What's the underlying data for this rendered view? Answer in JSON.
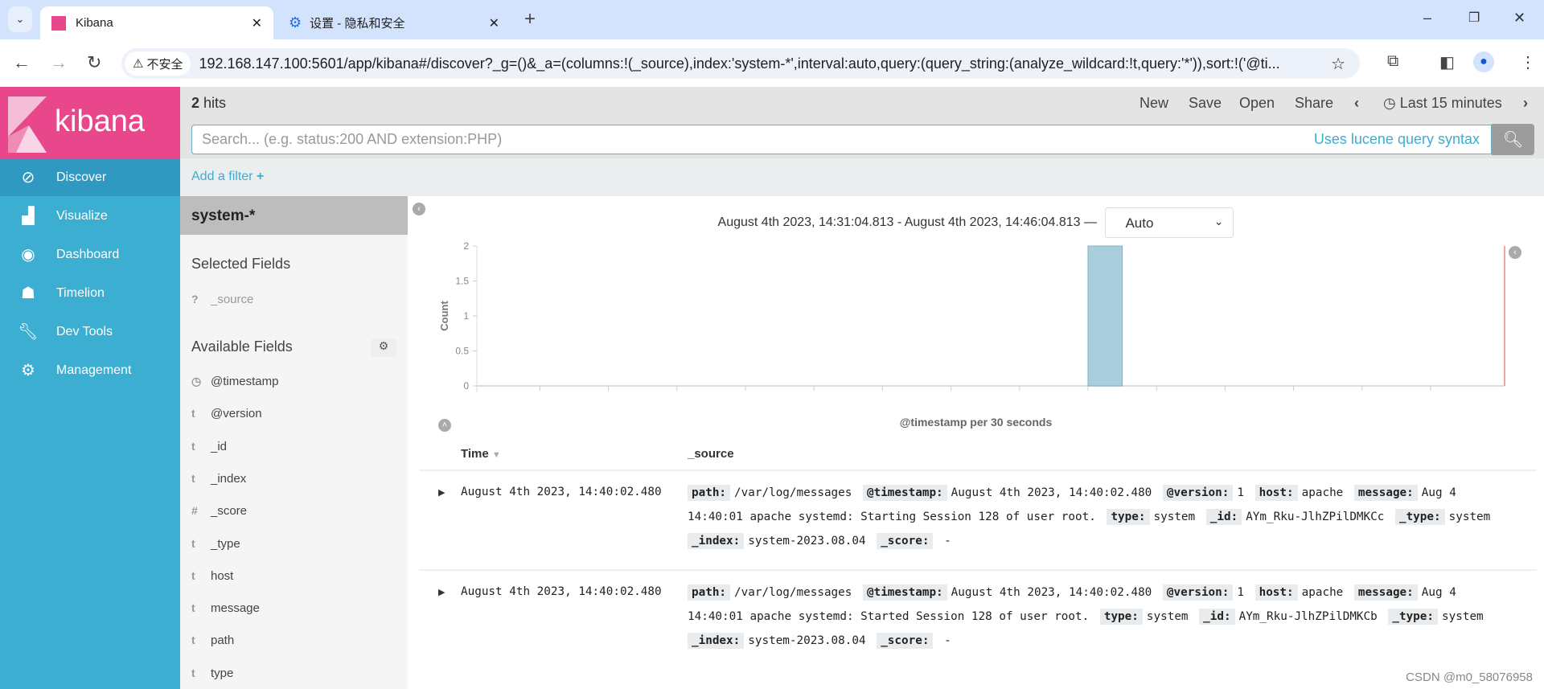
{
  "browser": {
    "tabs": [
      {
        "title": "Kibana",
        "active": true
      },
      {
        "title": "设置 - 隐私和安全",
        "active": false
      }
    ],
    "security_label": "不安全",
    "url": "192.168.147.100:5601/app/kibana#/discover?_g=()&_a=(columns:!(_source),index:'system-*',interval:auto,query:(query_string:(analyze_wildcard:!t,query:'*')),sort:!('@ti..."
  },
  "nav": {
    "logo": "kibana",
    "items": [
      {
        "label": "Discover",
        "icon": "compass-icon",
        "active": true
      },
      {
        "label": "Visualize",
        "icon": "bar-chart-icon"
      },
      {
        "label": "Dashboard",
        "icon": "dashboard-icon"
      },
      {
        "label": "Timelion",
        "icon": "timelion-icon"
      },
      {
        "label": "Dev Tools",
        "icon": "wrench-icon"
      },
      {
        "label": "Management",
        "icon": "gear-icon"
      }
    ]
  },
  "topbar": {
    "hits_count": "2",
    "hits_label": "hits",
    "menu": [
      "New",
      "Save",
      "Open",
      "Share"
    ],
    "time_range": "Last 15 minutes"
  },
  "search": {
    "placeholder": "Search... (e.g. status:200 AND extension:PHP)",
    "hint": "Uses lucene query syntax"
  },
  "filter": {
    "add_label": "Add a filter"
  },
  "fields": {
    "index_pattern": "system-*",
    "selected_title": "Selected Fields",
    "selected": [
      {
        "type": "?",
        "name": "_source"
      }
    ],
    "available_title": "Available Fields",
    "available": [
      {
        "type": "clock",
        "name": "@timestamp"
      },
      {
        "type": "t",
        "name": "@version"
      },
      {
        "type": "t",
        "name": "_id"
      },
      {
        "type": "t",
        "name": "_index"
      },
      {
        "type": "#",
        "name": "_score"
      },
      {
        "type": "t",
        "name": "_type"
      },
      {
        "type": "t",
        "name": "host"
      },
      {
        "type": "t",
        "name": "message"
      },
      {
        "type": "t",
        "name": "path"
      },
      {
        "type": "t",
        "name": "type"
      }
    ]
  },
  "main": {
    "date_range": "August 4th 2023, 14:31:04.813 - August 4th 2023, 14:46:04.813 —",
    "interval": "Auto"
  },
  "chart_data": {
    "type": "bar",
    "xlabel": "@timestamp per 30 seconds",
    "ylabel": "Count",
    "x_range": [
      "14:31:04.813",
      "14:46:04.813"
    ],
    "ylim": [
      0,
      2
    ],
    "yticks": [
      "0",
      "0.5",
      "1",
      "1.5",
      "2"
    ],
    "xticks": [
      "14:32:00",
      "14:33:00",
      "14:34:00",
      "14:35:00",
      "14:36:00",
      "14:37:00",
      "14:38:00",
      "14:39:00",
      "14:40:00",
      "14:41:00",
      "14:42:00",
      "14:43:00",
      "14:44:00",
      "14:45:00"
    ],
    "bars": [
      {
        "x": "14:40:00",
        "count": 2
      }
    ],
    "bar_color": "#a8cfdb",
    "now_line_color": "#f0a3a3"
  },
  "table": {
    "headers": [
      "Time",
      "_source"
    ],
    "rows": [
      {
        "time": "August 4th 2023, 14:40:02.480",
        "source": [
          [
            "path:",
            "/var/log/messages"
          ],
          [
            "@timestamp:",
            "August 4th 2023, 14:40:02.480"
          ],
          [
            "@version:",
            "1"
          ],
          [
            "host:",
            "apache"
          ],
          [
            "message:",
            "Aug 4 14:40:01 apache systemd: Starting Session 128 of user root."
          ],
          [
            "type:",
            "system"
          ],
          [
            "_id:",
            "AYm_Rku-JlhZPilDMKCc"
          ],
          [
            "_type:",
            "system"
          ],
          [
            "_index:",
            "system-2023.08.04"
          ],
          [
            "_score:",
            " -"
          ]
        ]
      },
      {
        "time": "August 4th 2023, 14:40:02.480",
        "source": [
          [
            "path:",
            "/var/log/messages"
          ],
          [
            "@timestamp:",
            "August 4th 2023, 14:40:02.480"
          ],
          [
            "@version:",
            "1"
          ],
          [
            "host:",
            "apache"
          ],
          [
            "message:",
            "Aug 4 14:40:01 apache systemd: Started Session 128 of user root."
          ],
          [
            "type:",
            "system"
          ],
          [
            "_id:",
            "AYm_Rku-JlhZPilDMKCb"
          ],
          [
            "_type:",
            "system"
          ],
          [
            "_index:",
            "system-2023.08.04"
          ],
          [
            "_score:",
            " -"
          ]
        ]
      }
    ]
  },
  "watermark": "CSDN @m0_58076958"
}
